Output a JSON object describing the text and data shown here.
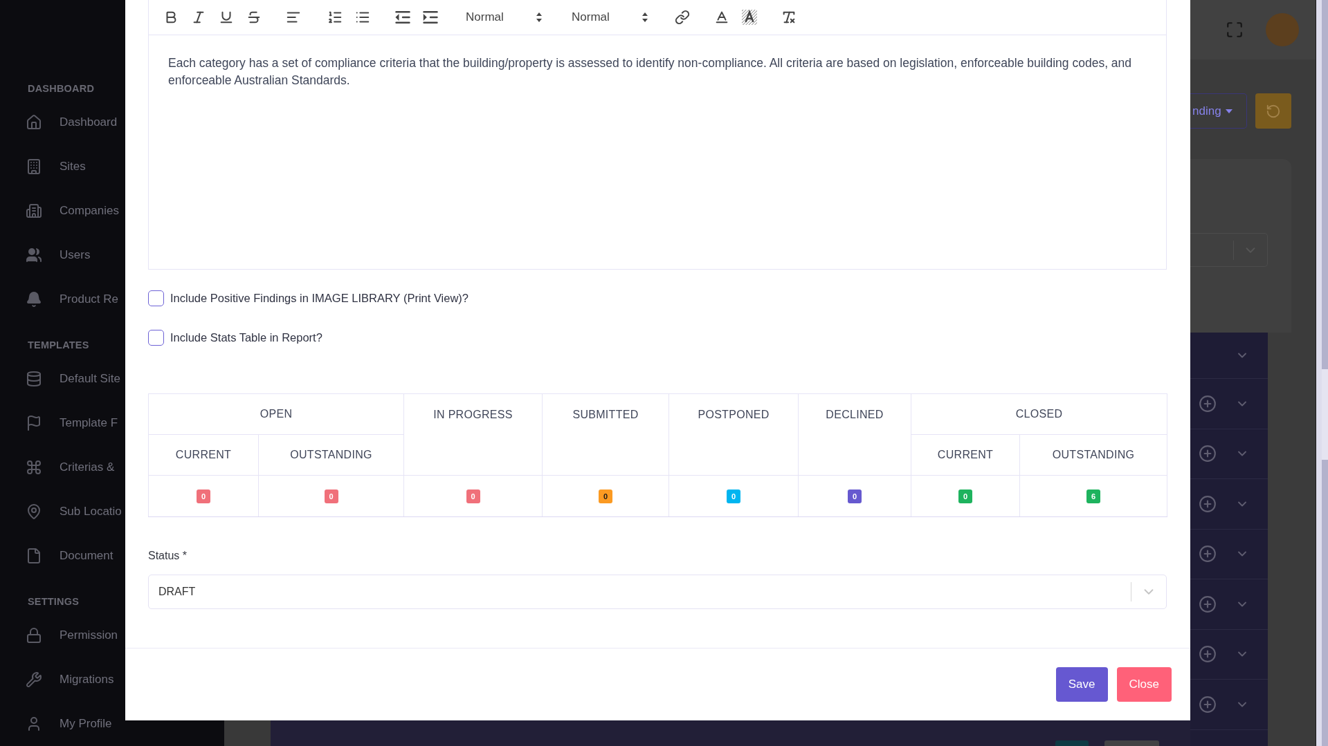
{
  "sidebar": {
    "sections": [
      {
        "title": "DASHBOARD",
        "items": [
          {
            "label": "Dashboard"
          },
          {
            "label": "Sites"
          },
          {
            "label": "Companies"
          },
          {
            "label": "Users"
          },
          {
            "label": "Product Re"
          }
        ]
      },
      {
        "title": "TEMPLATES",
        "items": [
          {
            "label": "Default Site"
          },
          {
            "label": "Template F"
          },
          {
            "label": "Criterias &"
          },
          {
            "label": "Sub Locatio"
          },
          {
            "label": "Document"
          }
        ]
      },
      {
        "title": "SETTINGS",
        "items": [
          {
            "label": "Permission"
          },
          {
            "label": "Migrations"
          },
          {
            "label": "My Profile"
          }
        ]
      }
    ]
  },
  "background_page": {
    "filter_button": {
      "label": "nding"
    }
  },
  "modal": {
    "toolbar": {
      "pickers": [
        {
          "value": "Normal"
        },
        {
          "value": "Normal"
        }
      ]
    },
    "editor": {
      "text": "Each category has a set of compliance criteria that the building/property is assessed to identify non-compliance. All criteria are based on legislation, enforceable building codes, and enforceable Australian Standards."
    },
    "options": [
      {
        "label": "Include Positive Findings in IMAGE LIBRARY (Print View)?",
        "checked": false
      },
      {
        "label": "Include Stats Table in Report?",
        "checked": false
      }
    ],
    "stats_table": {
      "groups": [
        {
          "kind": "split",
          "label": "OPEN",
          "columns": [
            {
              "label": "CURRENT",
              "count": "0",
              "color": "#f0707a"
            },
            {
              "label": "OUTSTANDING",
              "count": "0",
              "color": "#f0707a"
            }
          ]
        },
        {
          "kind": "single",
          "label": "IN PROGRESS",
          "count": "0",
          "color": "#f0707a"
        },
        {
          "kind": "single",
          "label": "SUBMITTED",
          "count": "0",
          "color": "#fb9a22"
        },
        {
          "kind": "single",
          "label": "POSTPONED",
          "count": "0",
          "color": "#00b5f0"
        },
        {
          "kind": "single",
          "label": "DECLINED",
          "count": "0",
          "color": "#6659cf"
        },
        {
          "kind": "split",
          "label": "CLOSED",
          "columns": [
            {
              "label": "CURRENT",
              "count": "0",
              "color": "#1eb35e"
            },
            {
              "label": "OUTSTANDING",
              "count": "6",
              "color": "#1eb35e"
            }
          ]
        }
      ]
    },
    "status": {
      "label": "Status *",
      "value": "DRAFT"
    },
    "buttons": [
      {
        "kind": "primary",
        "label": "Save"
      },
      {
        "kind": "danger",
        "label": "Close"
      }
    ]
  }
}
